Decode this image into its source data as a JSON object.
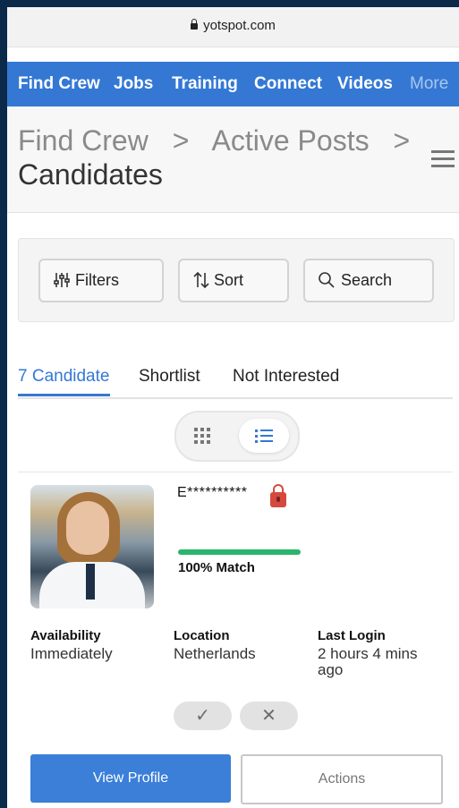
{
  "browser": {
    "url": "yotspot.com"
  },
  "nav": {
    "items": [
      "Find Crew",
      "Jobs",
      "Training",
      "Connect",
      "Videos",
      "More"
    ]
  },
  "breadcrumb": {
    "part1": "Find Crew",
    "sep": ">",
    "part2": "Active Posts",
    "current": "Candidates"
  },
  "toolbar": {
    "filters_label": "Filters",
    "sort_label": "Sort",
    "search_label": "Search"
  },
  "tabs": [
    "7 Candidate",
    "Shortlist",
    "Not Interested"
  ],
  "candidate": {
    "name": "E**********",
    "match_percent": 100,
    "match_text": "100% Match",
    "availability_label": "Availability",
    "availability_value": "Immediately",
    "location_label": "Location",
    "location_value": "Netherlands",
    "last_login_label": "Last Login",
    "last_login_value_line1": "2 hours 4 mins",
    "last_login_value_line2": "ago",
    "accept_icon": "✓",
    "reject_icon": "✕",
    "view_profile_label": "View Profile",
    "actions_label": "Actions"
  },
  "colors": {
    "accent": "#3478d4",
    "match_bar": "#29b56b",
    "lock": "#d44a3f"
  }
}
